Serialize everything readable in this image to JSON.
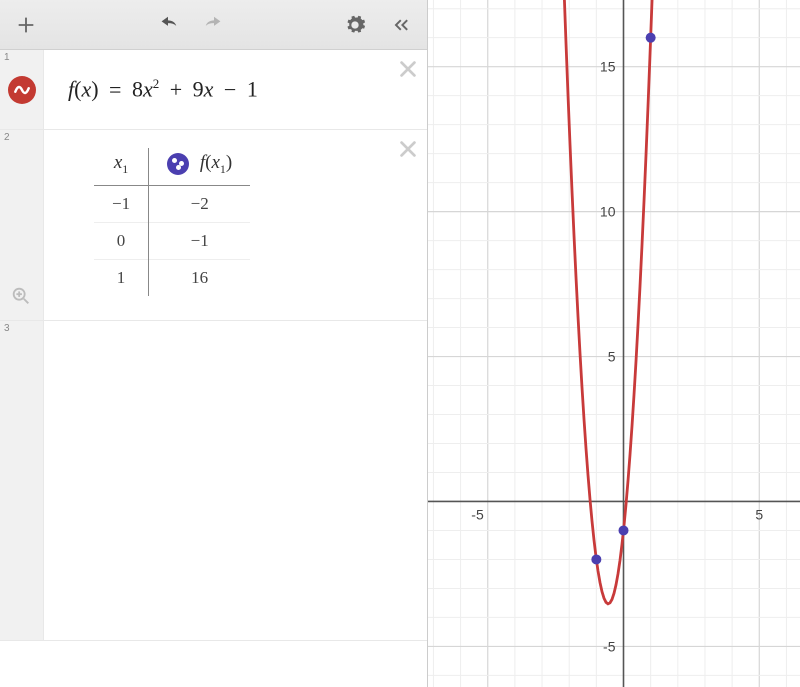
{
  "toolbar": {
    "add_tooltip": "Add item",
    "undo_tooltip": "Undo",
    "redo_tooltip": "Redo",
    "settings_tooltip": "Settings",
    "collapse_tooltip": "Collapse panel"
  },
  "rows": {
    "r1": {
      "index": "1",
      "formula_parts": {
        "fn": "f",
        "lp": "(",
        "var": "x",
        "rp": ")",
        "eq": "=",
        "c1": "8",
        "v1": "x",
        "e1": "2",
        "op1": "+",
        "c2": "9",
        "v2": "x",
        "op2": "−",
        "c3": "1"
      }
    },
    "r2": {
      "index": "2",
      "header": {
        "x": "x",
        "xsub": "1",
        "fx_pre": "f",
        "fx_lp": "(",
        "fx_var": "x",
        "fx_sub": "1",
        "fx_rp": ")"
      },
      "data": [
        {
          "x": "−1",
          "fx": "−2"
        },
        {
          "x": "0",
          "fx": "−1"
        },
        {
          "x": "1",
          "fx": "16"
        }
      ]
    },
    "r3": {
      "index": "3"
    }
  },
  "chart_data": {
    "type": "line",
    "title": "",
    "xlabel": "",
    "ylabel": "",
    "xlim": [
      -7.2,
      6.5
    ],
    "ylim": [
      -6.4,
      17.3
    ],
    "grid": true,
    "ticks_x": [
      -5,
      0,
      5
    ],
    "ticks_y": [
      -5,
      5,
      10,
      15
    ],
    "series": [
      {
        "name": "f(x) = 8x^2 + 9x - 1",
        "color": "#c83a3a",
        "formula": "8*x*x + 9*x - 1"
      }
    ],
    "points": [
      {
        "x": -1,
        "y": -2,
        "color": "#4b3fb0"
      },
      {
        "x": 0,
        "y": -1,
        "color": "#4b3fb0"
      },
      {
        "x": 1,
        "y": 16,
        "color": "#4b3fb0"
      }
    ],
    "tick_labels": {
      "-5x": "-5",
      "5x": "5",
      "-5y": "-5",
      "5y": "5",
      "10y": "10",
      "15y": "15"
    }
  }
}
